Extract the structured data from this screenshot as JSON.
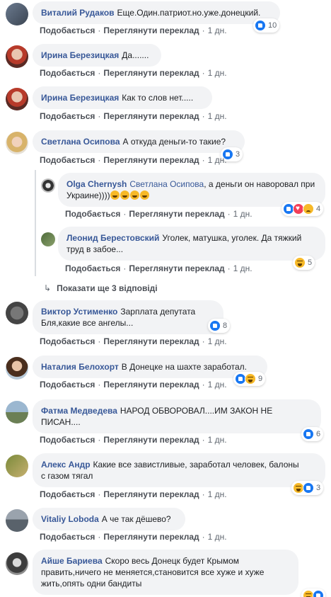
{
  "actions": {
    "like": "Подобається",
    "translate": "Переглянути переклад",
    "sep": "·"
  },
  "comments": [
    {
      "author": "Виталий Рудаков",
      "text": "Еще.Один.патриот.но.уже.донецкий.",
      "time": "1 дн.",
      "reactions": [
        "like"
      ],
      "count": "10",
      "avatar": "photo"
    },
    {
      "author": "Ирина Березицкая",
      "text": "Да.......",
      "time": "1 дн.",
      "avatar": "irina"
    },
    {
      "author": "Ирина Березицкая",
      "text": "Как то слов нет.....",
      "time": "1 дн.",
      "avatar": "irina"
    },
    {
      "author": "Светлана Осипова",
      "text": "А откуда деньги-то такие?",
      "time": "1 дн.",
      "reactions": [
        "like"
      ],
      "count": "3",
      "avatar": "svetlana"
    },
    {
      "author": "Olga Chernysh",
      "mention": "Светлана Осипова",
      "text": ", а деньги он наворовал при Украине))))",
      "time": "1 дн.",
      "reactions": [
        "like",
        "love",
        "sad"
      ],
      "count": "4",
      "avatar": "olga"
    },
    {
      "author": "Леонид Берестовский",
      "text": "Уголек, матушка, уголек. Да тяжкий труд в забое...",
      "time": "1 дн.",
      "reactions": [
        "haha"
      ],
      "count": "5",
      "avatar": "leonid"
    },
    {
      "author": "Виктор Устименко",
      "text_line1": "Зарплата депутата",
      "text_line2": "Бля,какие все ангелы...",
      "time": "1 дн.",
      "reactions": [
        "like"
      ],
      "count": "8",
      "avatar": "viktor"
    },
    {
      "author": "Наталия Белохорт",
      "text": "В Донецке на шахте заработал.",
      "time": "1 дн.",
      "reactions": [
        "like",
        "haha"
      ],
      "count": "9",
      "avatar": "natalia"
    },
    {
      "author": "Фатма Медведева",
      "text_line1": "НАРОД ОБВОРОВАЛ....ИМ ЗАКОН НЕ",
      "text_line2": "ПИСАН....",
      "time": "1 дн.",
      "reactions": [
        "like"
      ],
      "count": "6",
      "avatar": "fatma"
    },
    {
      "author": "Алекс Андр",
      "text_line1": "Какие все завистливые, заработал человек, балоны",
      "text_line2": "с газом тягал",
      "time": "1 дн.",
      "reactions": [
        "haha",
        "like"
      ],
      "count": "3",
      "avatar": "aleks"
    },
    {
      "author": "Vitaliy Loboda",
      "text": "А че так дёшево?",
      "time": "1 дн.",
      "avatar": "vitaliy"
    },
    {
      "author": "Айше Бариева",
      "text_line1": "Скоро весь Донецк будет Крымом",
      "text_line2": "править,ничего не меняется,становится все хуже и хуже",
      "text_line3": "жить,опять одни бандиты",
      "reactions": [
        "haha",
        "like"
      ],
      "avatar": "ayshe"
    }
  ],
  "more_replies": "Показати ще 3 відповіді"
}
